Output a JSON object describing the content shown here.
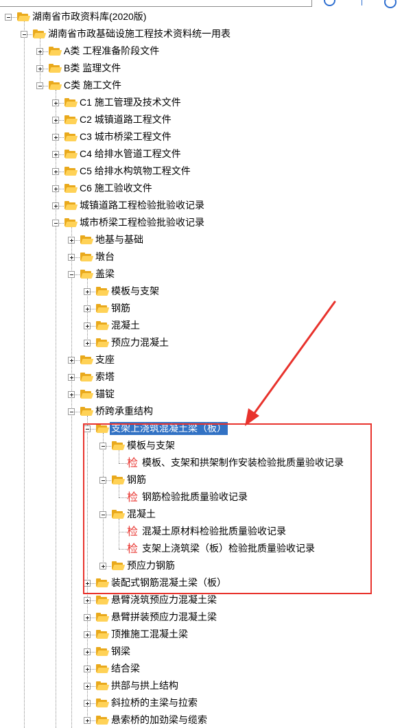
{
  "colors": {
    "selection": "#3272c4",
    "annotation_red": "#e8322c",
    "folder_yellow": "#ffd257",
    "doc_icon_red": "#e8332e"
  },
  "doc_icon_glyph": "检",
  "nodes": [
    {
      "label": "湖南省市政资料库(2020版)",
      "toggle": "minus",
      "icon": "folder"
    },
    {
      "label": "湖南省市政基础设施工程技术资料统一用表",
      "toggle": "minus",
      "icon": "folder"
    },
    {
      "label": "A类 工程准备阶段文件",
      "toggle": "plus",
      "icon": "folder"
    },
    {
      "label": "B类 监理文件",
      "toggle": "plus",
      "icon": "folder"
    },
    {
      "label": "C类 施工文件",
      "toggle": "minus",
      "icon": "folder"
    },
    {
      "label": "C1 施工管理及技术文件",
      "toggle": "plus",
      "icon": "folder"
    },
    {
      "label": "C2 城镇道路工程文件",
      "toggle": "plus",
      "icon": "folder"
    },
    {
      "label": "C3 城市桥梁工程文件",
      "toggle": "plus",
      "icon": "folder"
    },
    {
      "label": "C4 给排水管道工程文件",
      "toggle": "plus",
      "icon": "folder"
    },
    {
      "label": "C5 给排水构筑物工程文件",
      "toggle": "plus",
      "icon": "folder"
    },
    {
      "label": "C6 施工验收文件",
      "toggle": "plus",
      "icon": "folder"
    },
    {
      "label": "城镇道路工程检验批验收记录",
      "toggle": "plus",
      "icon": "folder"
    },
    {
      "label": "城市桥梁工程检验批验收记录",
      "toggle": "minus",
      "icon": "folder"
    },
    {
      "label": "地基与基础",
      "toggle": "plus",
      "icon": "folder"
    },
    {
      "label": "墩台",
      "toggle": "plus",
      "icon": "folder"
    },
    {
      "label": "盖梁",
      "toggle": "minus",
      "icon": "folder"
    },
    {
      "label": "模板与支架",
      "toggle": "plus",
      "icon": "folder"
    },
    {
      "label": "钢筋",
      "toggle": "plus",
      "icon": "folder"
    },
    {
      "label": "混凝土",
      "toggle": "plus",
      "icon": "folder"
    },
    {
      "label": "预应力混凝土",
      "toggle": "plus",
      "icon": "folder"
    },
    {
      "label": "支座",
      "toggle": "plus",
      "icon": "folder"
    },
    {
      "label": "索塔",
      "toggle": "plus",
      "icon": "folder"
    },
    {
      "label": "锚锭",
      "toggle": "plus",
      "icon": "folder"
    },
    {
      "label": "桥跨承重结构",
      "toggle": "minus",
      "icon": "folder"
    },
    {
      "label": "支架上浇筑混凝土梁（板）",
      "toggle": "minus",
      "icon": "folder",
      "selected": true
    },
    {
      "label": "模板与支架",
      "toggle": "minus",
      "icon": "folder"
    },
    {
      "label": "模板、支架和拱架制作安装检验批质量验收记录",
      "toggle": "",
      "icon": "doc"
    },
    {
      "label": "钢筋",
      "toggle": "minus",
      "icon": "folder"
    },
    {
      "label": "钢筋检验批质量验收记录",
      "toggle": "",
      "icon": "doc"
    },
    {
      "label": "混凝土",
      "toggle": "minus",
      "icon": "folder"
    },
    {
      "label": "混凝土原材料检验批质量验收记录",
      "toggle": "",
      "icon": "doc"
    },
    {
      "label": "支架上浇筑梁（板）检验批质量验收记录",
      "toggle": "",
      "icon": "doc"
    },
    {
      "label": "预应力钢筋",
      "toggle": "plus",
      "icon": "folder"
    },
    {
      "label": "装配式钢筋混凝土梁（板）",
      "toggle": "plus",
      "icon": "folder"
    },
    {
      "label": "悬臂浇筑预应力混凝土梁",
      "toggle": "plus",
      "icon": "folder"
    },
    {
      "label": "悬臂拼装预应力混凝土梁",
      "toggle": "plus",
      "icon": "folder"
    },
    {
      "label": "顶推施工混凝土梁",
      "toggle": "plus",
      "icon": "folder"
    },
    {
      "label": "钢梁",
      "toggle": "plus",
      "icon": "folder"
    },
    {
      "label": "结合梁",
      "toggle": "plus",
      "icon": "folder"
    },
    {
      "label": "拱部与拱上结构",
      "toggle": "plus",
      "icon": "folder"
    },
    {
      "label": "斜拉桥的主梁与拉索",
      "toggle": "plus",
      "icon": "folder"
    },
    {
      "label": "悬索桥的加劲梁与缆索",
      "toggle": "plus",
      "icon": "folder"
    }
  ]
}
